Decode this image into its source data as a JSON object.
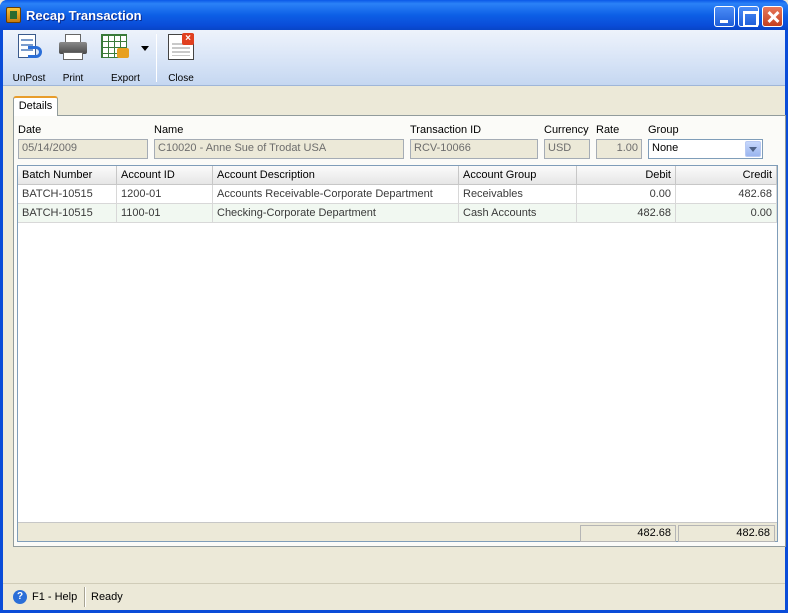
{
  "window": {
    "title": "Recap Transaction"
  },
  "toolbar": {
    "unpost_label": "UnPost",
    "print_label": "Print",
    "export_label": "Export",
    "close_label": "Close"
  },
  "tabs": [
    {
      "label": "Details"
    }
  ],
  "form": {
    "date": {
      "label": "Date",
      "value": "05/14/2009"
    },
    "name": {
      "label": "Name",
      "value": "C10020 - Anne Sue of Trodat USA"
    },
    "transaction_id": {
      "label": "Transaction ID",
      "value": "RCV-10066"
    },
    "currency": {
      "label": "Currency",
      "value": "USD"
    },
    "rate": {
      "label": "Rate",
      "value": "1.00"
    },
    "group": {
      "label": "Group",
      "value": "None"
    }
  },
  "grid": {
    "columns": [
      "Batch Number",
      "Account ID",
      "Account Description",
      "Account Group",
      "Debit",
      "Credit"
    ],
    "rows": [
      {
        "batch": "BATCH-10515",
        "account_id": "1200-01",
        "description": "Accounts Receivable-Corporate Department",
        "group": "Receivables",
        "debit": "0.00",
        "credit": "482.68"
      },
      {
        "batch": "BATCH-10515",
        "account_id": "1100-01",
        "description": "Checking-Corporate Department",
        "group": "Cash Accounts",
        "debit": "482.68",
        "credit": "0.00"
      }
    ],
    "totals": {
      "debit": "482.68",
      "credit": "482.68"
    }
  },
  "statusbar": {
    "help": "F1 - Help",
    "status": "Ready"
  },
  "colors": {
    "titlebar": "#0a4cd8",
    "accent_tab": "#e89d2b"
  }
}
